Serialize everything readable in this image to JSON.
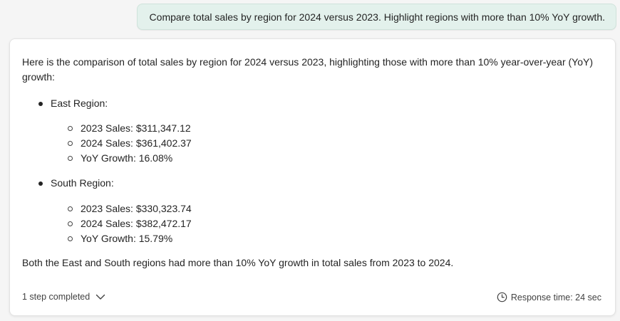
{
  "user_message": "Compare total sales by region for 2024 versus 2023. Highlight regions with more than 10% YoY growth.",
  "response": {
    "intro": "Here is the comparison of total sales by region for 2024 versus 2023, highlighting those with more than 10% year-over-year (YoY) growth:",
    "regions": [
      {
        "label": "East Region:",
        "details": [
          "2023 Sales: $311,347.12",
          "2024 Sales: $361,402.37",
          "YoY Growth: 16.08%"
        ]
      },
      {
        "label": "South Region:",
        "details": [
          "2023 Sales: $330,323.74",
          "2024 Sales: $382,472.17",
          "YoY Growth: 15.79%"
        ]
      }
    ],
    "summary": "Both the East and South regions had more than 10% YoY growth in total sales from 2023 to 2024.",
    "steps_label": "1 step completed",
    "response_time": "Response time: 24 sec"
  },
  "icons": {
    "steps_toggle": "chevron-down-icon",
    "response_time": "clock-icon"
  },
  "colors": {
    "user_bubble": "#e3f1ec",
    "page_background": "#f5f5f5",
    "card_background": "#ffffff"
  }
}
